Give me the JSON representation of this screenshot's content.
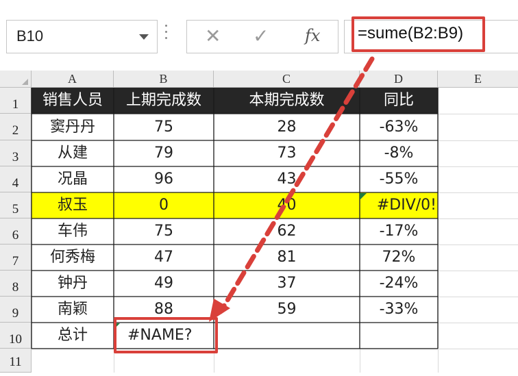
{
  "formula_bar": {
    "name_box": "B10",
    "cancel_icon": "✕",
    "enter_icon": "✓",
    "fx_label": "fx",
    "formula": "=sume(B2:B9)"
  },
  "columns": [
    "A",
    "B",
    "C",
    "D",
    "E"
  ],
  "rows": [
    "1",
    "2",
    "3",
    "4",
    "5",
    "6",
    "7",
    "8",
    "9",
    "10",
    "11"
  ],
  "table": {
    "headers": [
      "销售人员",
      "上期完成数",
      "本期完成数",
      "同比"
    ],
    "data": [
      [
        "窦丹丹",
        "75",
        "28",
        "-63%"
      ],
      [
        "从建",
        "79",
        "73",
        "-8%"
      ],
      [
        "况晶",
        "96",
        "43",
        "-55%"
      ],
      [
        "叔玉",
        "0",
        "40",
        "#DIV/0!"
      ],
      [
        "车伟",
        "75",
        "62",
        "-17%"
      ],
      [
        "何秀梅",
        "47",
        "81",
        "72%"
      ],
      [
        "钟丹",
        "49",
        "37",
        "-24%"
      ],
      [
        "南颖",
        "88",
        "59",
        "-33%"
      ]
    ],
    "total_label": "总计",
    "total_value": "#NAME?"
  },
  "colors": {
    "highlight_red": "#d9403a",
    "header_fill": "#262626",
    "yellow_row": "#ffff00"
  }
}
